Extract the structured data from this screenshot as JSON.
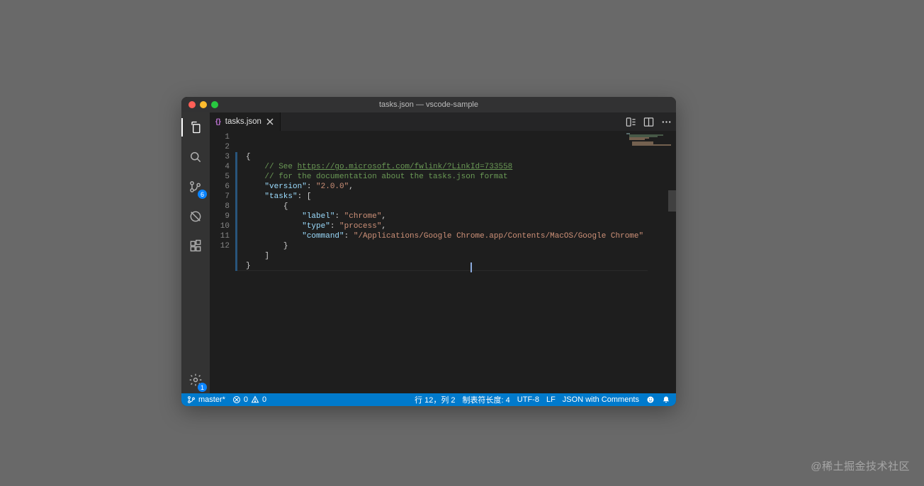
{
  "window": {
    "title": "tasks.json — vscode-sample"
  },
  "activitybar": {
    "scm_badge": "6",
    "settings_badge": "1"
  },
  "tab": {
    "label": "tasks.json",
    "icon_text": "{}"
  },
  "code": {
    "lines": [
      {
        "n": "1",
        "indent": 0,
        "segs": [
          {
            "c": "tok-brace",
            "t": "{"
          }
        ]
      },
      {
        "n": "2",
        "indent": 4,
        "segs": [
          {
            "c": "tok-comment",
            "t": "// See "
          },
          {
            "c": "tok-link",
            "t": "https://go.microsoft.com/fwlink/?LinkId=733558"
          }
        ]
      },
      {
        "n": "3",
        "indent": 4,
        "segs": [
          {
            "c": "tok-comment",
            "t": "// for the documentation about the tasks.json format"
          }
        ]
      },
      {
        "n": "4",
        "indent": 4,
        "segs": [
          {
            "c": "tok-key",
            "t": "\"version\""
          },
          {
            "c": "tok-punct",
            "t": ": "
          },
          {
            "c": "tok-str",
            "t": "\"2.0.0\""
          },
          {
            "c": "tok-punct",
            "t": ","
          }
        ]
      },
      {
        "n": "5",
        "indent": 4,
        "segs": [
          {
            "c": "tok-key",
            "t": "\"tasks\""
          },
          {
            "c": "tok-punct",
            "t": ": ["
          }
        ]
      },
      {
        "n": "6",
        "indent": 8,
        "segs": [
          {
            "c": "tok-punct",
            "t": "{"
          }
        ]
      },
      {
        "n": "7",
        "indent": 12,
        "segs": [
          {
            "c": "tok-key",
            "t": "\"label\""
          },
          {
            "c": "tok-punct",
            "t": ": "
          },
          {
            "c": "tok-str",
            "t": "\"chrome\""
          },
          {
            "c": "tok-punct",
            "t": ","
          }
        ]
      },
      {
        "n": "8",
        "indent": 12,
        "segs": [
          {
            "c": "tok-key",
            "t": "\"type\""
          },
          {
            "c": "tok-punct",
            "t": ": "
          },
          {
            "c": "tok-str",
            "t": "\"process\""
          },
          {
            "c": "tok-punct",
            "t": ","
          }
        ]
      },
      {
        "n": "9",
        "indent": 12,
        "segs": [
          {
            "c": "tok-key",
            "t": "\"command\""
          },
          {
            "c": "tok-punct",
            "t": ": "
          },
          {
            "c": "tok-str",
            "t": "\"/Applications/Google Chrome.app/Contents/MacOS/Google Chrome\""
          }
        ]
      },
      {
        "n": "10",
        "indent": 8,
        "segs": [
          {
            "c": "tok-punct",
            "t": "}"
          }
        ]
      },
      {
        "n": "11",
        "indent": 4,
        "segs": [
          {
            "c": "tok-punct",
            "t": "]"
          }
        ]
      },
      {
        "n": "12",
        "indent": 0,
        "segs": [
          {
            "c": "tok-brace",
            "t": "}"
          }
        ]
      }
    ]
  },
  "statusbar": {
    "branch": "master*",
    "errors": "0",
    "warnings": "0",
    "cursor": "行 12，列 2",
    "tabsize": "制表符长度: 4",
    "encoding": "UTF-8",
    "eol": "LF",
    "lang": "JSON with Comments"
  },
  "watermark": "@稀土掘金技术社区"
}
